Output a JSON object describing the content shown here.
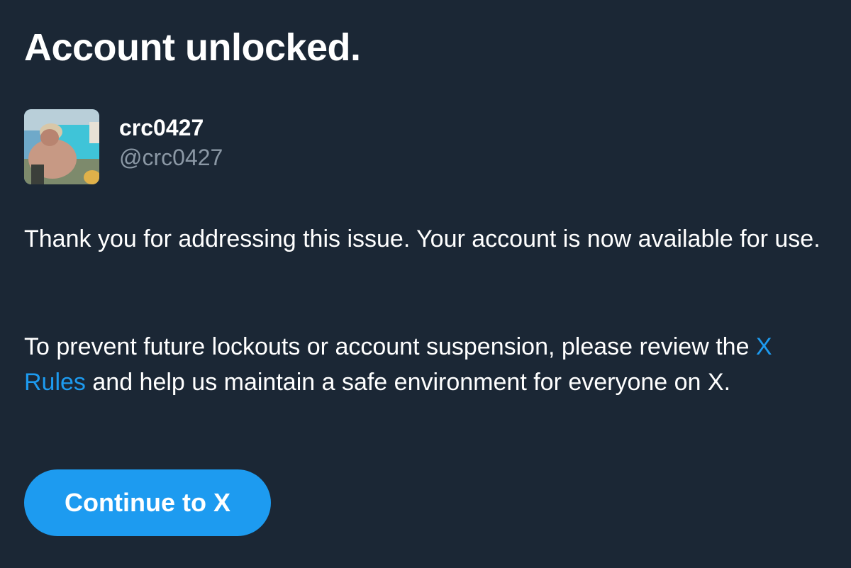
{
  "dialog": {
    "title": "Account unlocked."
  },
  "user": {
    "display_name": "crc0427",
    "handle": "@crc0427",
    "avatar_icon": "profile-photo"
  },
  "message": {
    "paragraph1": "Thank you for addressing this issue. Your account is now available for use.",
    "paragraph2_before_link": "To prevent future lockouts or account suspension, please review the ",
    "paragraph2_link": "X Rules",
    "paragraph2_after_link": " and help us maintain a safe environment for everyone on X."
  },
  "actions": {
    "continue_label": "Continue to X"
  },
  "colors": {
    "background": "#1b2735",
    "accent": "#1d9bf0",
    "secondary_text": "#8b98a5"
  }
}
